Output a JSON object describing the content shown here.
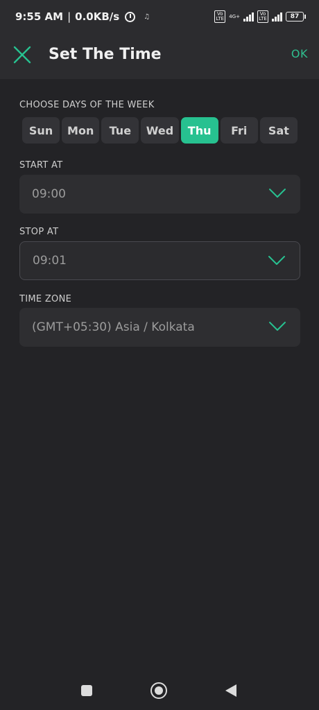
{
  "status_bar": {
    "time": "9:55 AM",
    "separator": "|",
    "speed": "0.0KB/s",
    "network_label": "4G+",
    "volte_1": "Vo LTE",
    "volte_2": "Vo LTE",
    "battery": "87"
  },
  "header": {
    "title": "Set The Time",
    "ok_label": "OK"
  },
  "days_section": {
    "label": "CHOOSE DAYS OF THE WEEK",
    "days": [
      {
        "label": "Sun",
        "selected": false
      },
      {
        "label": "Mon",
        "selected": false
      },
      {
        "label": "Tue",
        "selected": false
      },
      {
        "label": "Wed",
        "selected": false
      },
      {
        "label": "Thu",
        "selected": true
      },
      {
        "label": "Fri",
        "selected": false
      },
      {
        "label": "Sat",
        "selected": false
      }
    ]
  },
  "start": {
    "label": "START AT",
    "value": "09:00"
  },
  "stop": {
    "label": "STOP AT",
    "value": "09:01"
  },
  "timezone": {
    "label": "TIME ZONE",
    "value": "(GMT+05:30) Asia / Kolkata"
  },
  "colors": {
    "accent": "#27c190",
    "background": "#232326",
    "header": "#2c2c2f"
  },
  "icons": {
    "close": "close-icon",
    "chevron": "chevron-down-icon",
    "nav_recent": "square-icon",
    "nav_home": "home-circle-icon",
    "nav_back": "back-triangle-icon"
  }
}
